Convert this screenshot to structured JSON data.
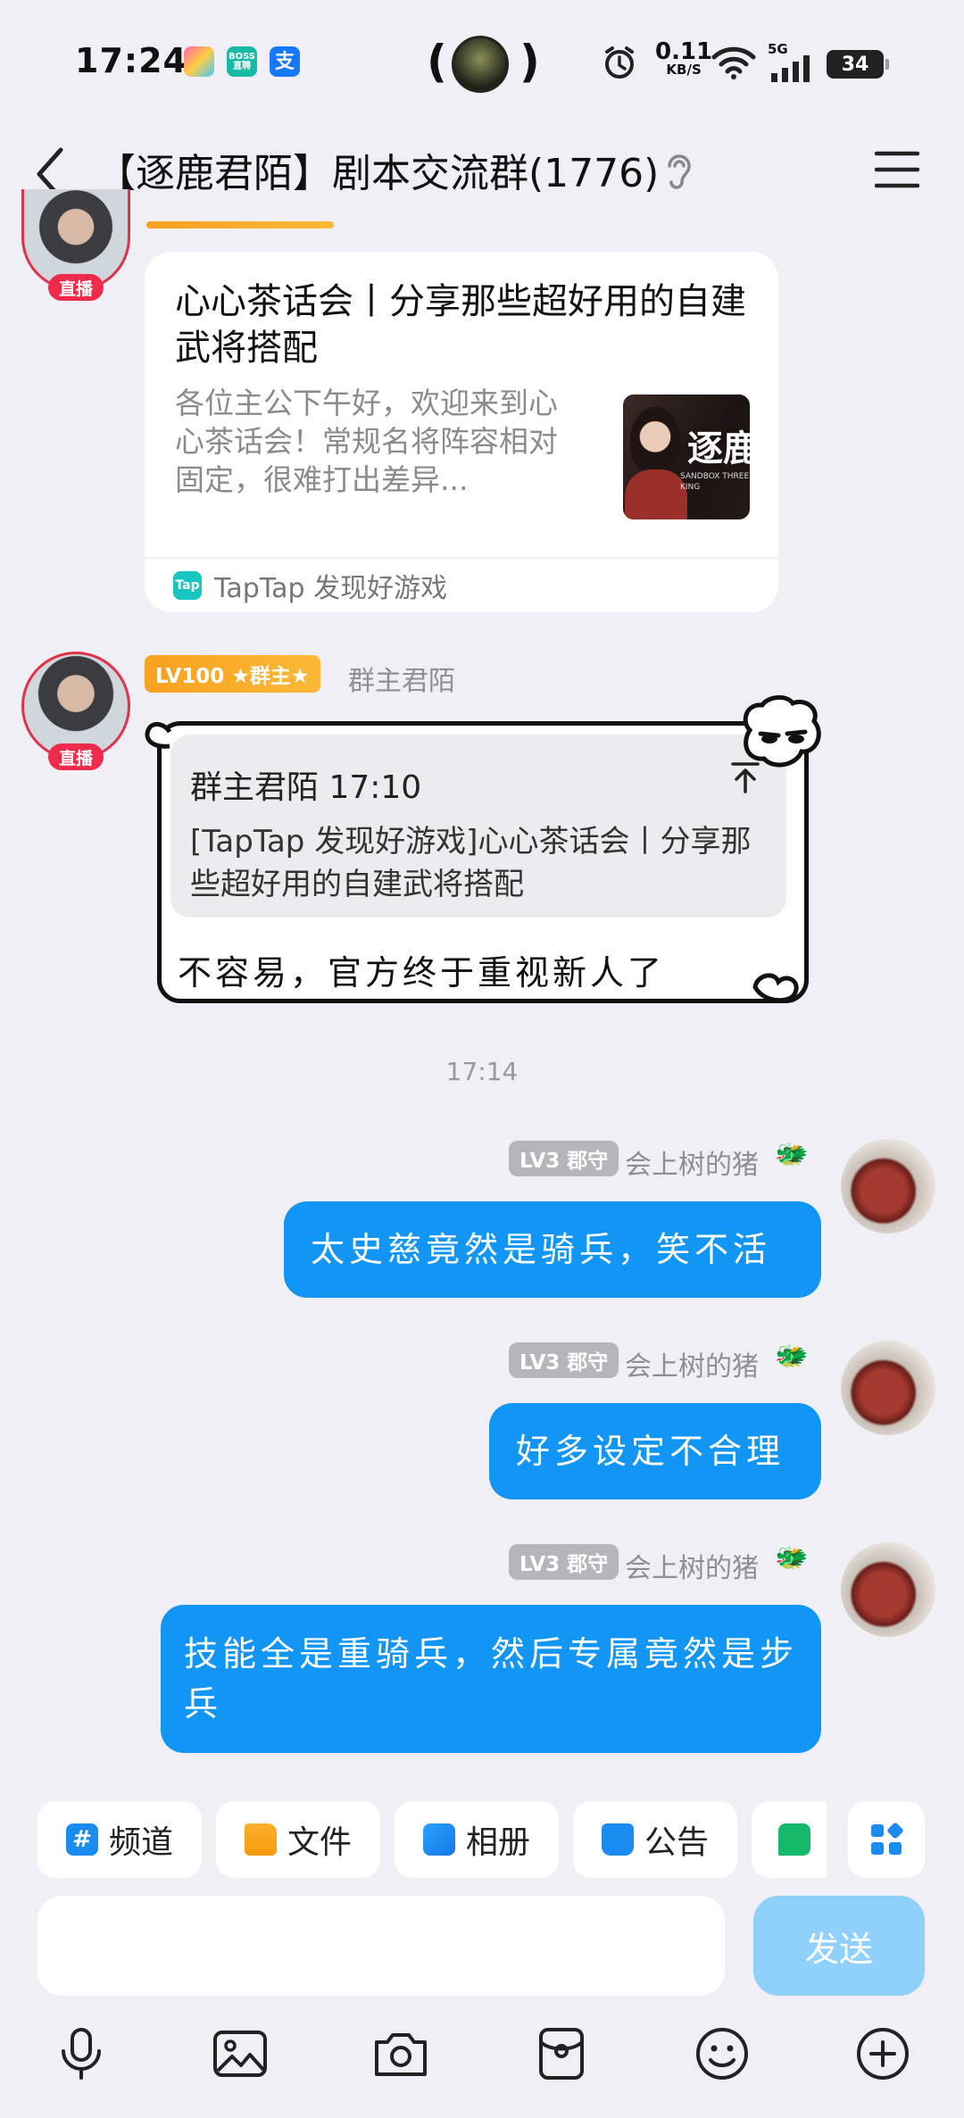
{
  "status_bar": {
    "time": "17:24",
    "app_boss": "BOSS\n直聘",
    "app_alipay": "支",
    "net_speed_value": "0.11",
    "net_speed_unit": "KB/S",
    "signal_label": "5G",
    "battery": "34"
  },
  "header": {
    "title": "【逐鹿君陌】剧本交流群(1776)"
  },
  "share_card": {
    "title": "心心茶话会丨分享那些超好用的自建武将搭配",
    "description": "各位主公下午好，欢迎来到心心茶话会！常规名将阵容相对固定，很难打出差异...",
    "thumbnail_text": "逐鹿",
    "thumbnail_subtext": "SANDBOX THREE KING",
    "source": "TapTap 发现好游戏",
    "source_icon_text": "Tap"
  },
  "owner_message": {
    "live_tag": "直播",
    "level_badge": "LV100 ★群主★",
    "sender": "群主君陌",
    "quote_header": "群主君陌 17:10",
    "quote_body": "[TapTap 发现好游戏]心心茶话会丨分享那些超好用的自建武将搭配",
    "text": "不容易，官方终于重视新人了"
  },
  "timestamp": "17:14",
  "my_messages": [
    {
      "level": "LV3 郡守",
      "sender": "会上树的猪",
      "text": "太史慈竟然是骑兵，笑不活"
    },
    {
      "level": "LV3 郡守",
      "sender": "会上树的猪",
      "text": "好多设定不合理"
    },
    {
      "level": "LV3 郡守",
      "sender": "会上树的猪",
      "text": "技能全是重骑兵，然后专属竟然是步兵"
    }
  ],
  "toolbar": {
    "channel": "频道",
    "files": "文件",
    "album": "相册",
    "notice": "公告"
  },
  "input": {
    "placeholder": "",
    "send_label": "发送"
  },
  "colors": {
    "accent_blue": "#1296f5",
    "send_disabled": "#8fd1fb",
    "live_red": "#ee2b4a",
    "background": "#f0eff5"
  }
}
